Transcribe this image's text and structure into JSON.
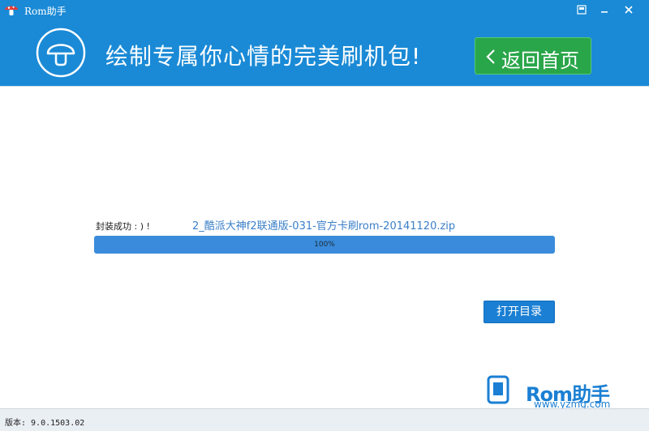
{
  "window": {
    "title": "Rom助手",
    "buttons": [
      "restore-icon",
      "minimize-icon",
      "close-icon"
    ]
  },
  "header": {
    "slogan": "绘制专属你心情的完美刷机包!",
    "home_button": "返回首页",
    "logo_icon": "mushroom-icon"
  },
  "main": {
    "status_label": "封装成功 : ) !",
    "file_name": "2_酷派大神f2联通版-031-官方卡刷rom-20141120.zip",
    "progress_percent": 100,
    "progress_text": "100%",
    "open_folder_button": "打开目录"
  },
  "watermark": {
    "brand": "Rom助手",
    "url": "www.yzmg.com"
  },
  "footer": {
    "version": "版本: 9.0.1503.02"
  },
  "colors": {
    "header_bg": "#1a8ad6",
    "home_button_bg": "#2aa64a",
    "progress_fill": "#3a8bdb",
    "link": "#3a7fc8"
  }
}
